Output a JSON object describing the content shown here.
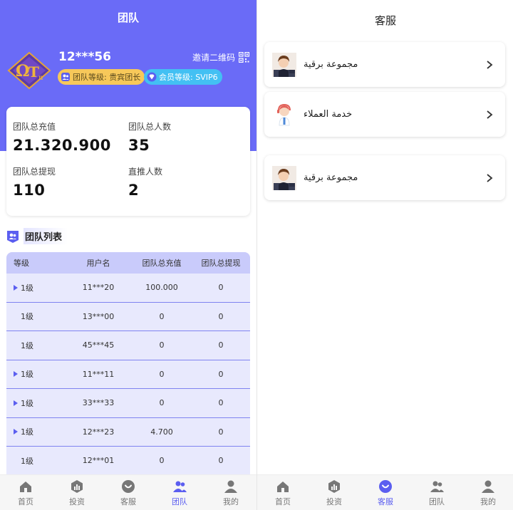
{
  "left": {
    "title": "团队",
    "user": {
      "name": "12***56"
    },
    "invite_label": "邀请二维码",
    "badges": {
      "team": "团队等级: 贵宾团长",
      "vip": "会员等级: SVIP6"
    },
    "stats": [
      {
        "label": "团队总充值",
        "value": "21.320.900"
      },
      {
        "label": "团队总人数",
        "value": "35"
      },
      {
        "label": "团队总提现",
        "value": "110"
      },
      {
        "label": "直推人数",
        "value": "2"
      }
    ],
    "list_title": "团队列表",
    "table": {
      "headers": [
        "等级",
        "用户名",
        "团队总充值",
        "团队总提现"
      ],
      "rows": [
        {
          "level": "1级",
          "user": "11***20",
          "recharge": "100.000",
          "withdraw": "0",
          "expandable": true
        },
        {
          "level": "1级",
          "user": "13***00",
          "recharge": "0",
          "withdraw": "0",
          "expandable": false
        },
        {
          "level": "1级",
          "user": "45***45",
          "recharge": "0",
          "withdraw": "0",
          "expandable": false
        },
        {
          "level": "1级",
          "user": "11***11",
          "recharge": "0",
          "withdraw": "0",
          "expandable": true
        },
        {
          "level": "1级",
          "user": "33***33",
          "recharge": "0",
          "withdraw": "0",
          "expandable": true
        },
        {
          "level": "1级",
          "user": "12***23",
          "recharge": "4.700",
          "withdraw": "0",
          "expandable": true
        },
        {
          "level": "1级",
          "user": "12***01",
          "recharge": "0",
          "withdraw": "0",
          "expandable": false
        }
      ]
    },
    "tabs": [
      {
        "label": "首页",
        "icon": "home-icon",
        "active": false
      },
      {
        "label": "投资",
        "icon": "invest-icon",
        "active": false
      },
      {
        "label": "客服",
        "icon": "heart-chat-icon",
        "active": false
      },
      {
        "label": "团队",
        "icon": "team-icon",
        "active": true
      },
      {
        "label": "我的",
        "icon": "profile-icon",
        "active": false
      }
    ]
  },
  "right": {
    "title": "客服",
    "items": [
      {
        "label": "مجموعة برقية",
        "icon": "agent-avatar-icon"
      },
      {
        "label": "خدمة العملاء",
        "icon": "support-avatar-icon"
      },
      {
        "label": "مجموعة برقية",
        "icon": "agent-avatar-icon"
      }
    ],
    "tabs": [
      {
        "label": "首页",
        "icon": "home-icon",
        "active": false
      },
      {
        "label": "投资",
        "icon": "invest-icon",
        "active": false
      },
      {
        "label": "客服",
        "icon": "heart-chat-icon",
        "active": true
      },
      {
        "label": "团队",
        "icon": "team-icon",
        "active": false
      },
      {
        "label": "我的",
        "icon": "profile-icon",
        "active": false
      }
    ]
  },
  "colors": {
    "primary": "#6a6bf7",
    "accent": "#5b5ef0",
    "team_badge": "#f7c85a",
    "vip_badge": "#43c0f3",
    "table_bg": "#e8e9fd",
    "table_header": "#c9cbfb"
  }
}
